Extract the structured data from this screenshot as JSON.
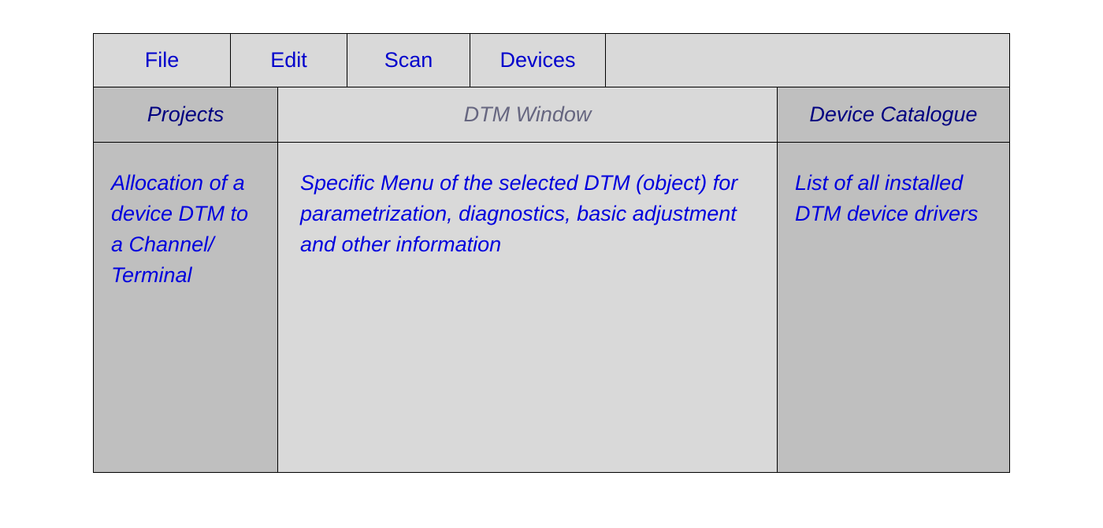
{
  "menu": {
    "file": "File",
    "edit": "Edit",
    "scan": "Scan",
    "devices": "Devices"
  },
  "panels": {
    "projects": {
      "title": "Projects",
      "description": "Allocation of a device DTM to a Channel/ Terminal"
    },
    "dtm_window": {
      "title": "DTM Window",
      "description": "Specific Menu of the selected DTM (object) for parametrization, diagnostics, basic adjustment and other information"
    },
    "catalogue": {
      "title": "Device Catalogue",
      "description": "List of all installed DTM device drivers"
    }
  }
}
